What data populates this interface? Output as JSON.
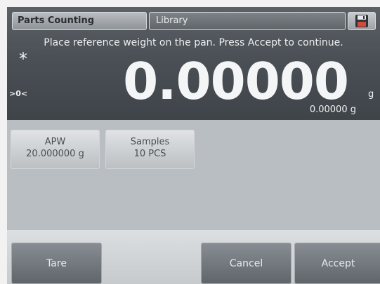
{
  "header": {
    "app_tab": "Parts Counting",
    "library_tab": "Library",
    "save_icon": "floppy-disk-icon"
  },
  "display": {
    "instruction": "Place reference weight on the pan.  Press Accept to continue.",
    "stability_indicator": "*",
    "center_of_zero": ">0<",
    "reading": "0.00000",
    "unit": "g",
    "secondary_reading": "0.00000 g"
  },
  "params": {
    "apw": {
      "label": "APW",
      "value": "20.000000 g"
    },
    "samples": {
      "label": "Samples",
      "value": "10 PCS"
    }
  },
  "softkeys": {
    "tare": "Tare",
    "cancel": "Cancel",
    "accept": "Accept"
  }
}
